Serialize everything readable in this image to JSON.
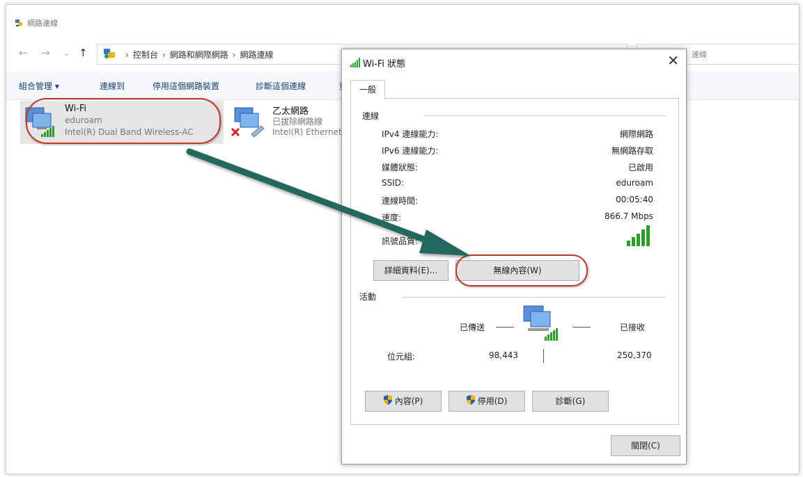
{
  "explorer": {
    "title": "網路連線",
    "nav": {
      "back": "←",
      "forward": "→",
      "recent": "⌄",
      "up": "↑"
    },
    "breadcrumb": [
      "控制台",
      "網路和網際網路",
      "網路連線"
    ],
    "search_hint": "連線",
    "commands": [
      "組合管理 ▾",
      "連線到",
      "停用這個網路裝置",
      "診斷這個連線",
      "重"
    ],
    "connections": [
      {
        "name": "Wi-Fi",
        "status": "eduroam",
        "adapter": "Intel(R) Dual Band Wireless-AC"
      },
      {
        "name": "乙太網路",
        "status": "已拔除網路線",
        "adapter": "Intel(R) Ethernet"
      }
    ]
  },
  "dialog": {
    "title": "Wi-Fi 狀態",
    "close": "✕",
    "tab": "一般",
    "connection_group": "連線",
    "rows": [
      {
        "label": "IPv4 連線能力:",
        "value": "網際網路"
      },
      {
        "label": "IPv6 連線能力:",
        "value": "無網路存取"
      },
      {
        "label": "媒體狀態:",
        "value": "已啟用"
      },
      {
        "label": "SSID:",
        "value": "eduroam"
      },
      {
        "label": "連線時間:",
        "value": "00:05:40"
      },
      {
        "label": "速度:",
        "value": "866.7 Mbps"
      }
    ],
    "signal_label": "訊號品質:",
    "details_button": "詳細資料(E)...",
    "wireless_props_button": "無線內容(W)",
    "activity_group": "活動",
    "sent_label": "已傳送",
    "received_label": "已接收",
    "bytes_label": "位元組:",
    "bytes_sent": "98,443",
    "bytes_received": "250,370",
    "properties_button": "內容(P)",
    "disable_button": "停用(D)",
    "diagnose_button": "診斷(G)",
    "close_button": "關閉(C)"
  },
  "colors": {
    "annotation_oval": "#c0392b",
    "annotation_arrow": "#22685f",
    "signal_green": "#2e9d2e",
    "link_blue": "#1b3f72"
  },
  "icons": [
    "network-icon",
    "wifi-signal-icon",
    "computer-icon",
    "ethernet-icon",
    "shield-icon",
    "close-icon"
  ]
}
